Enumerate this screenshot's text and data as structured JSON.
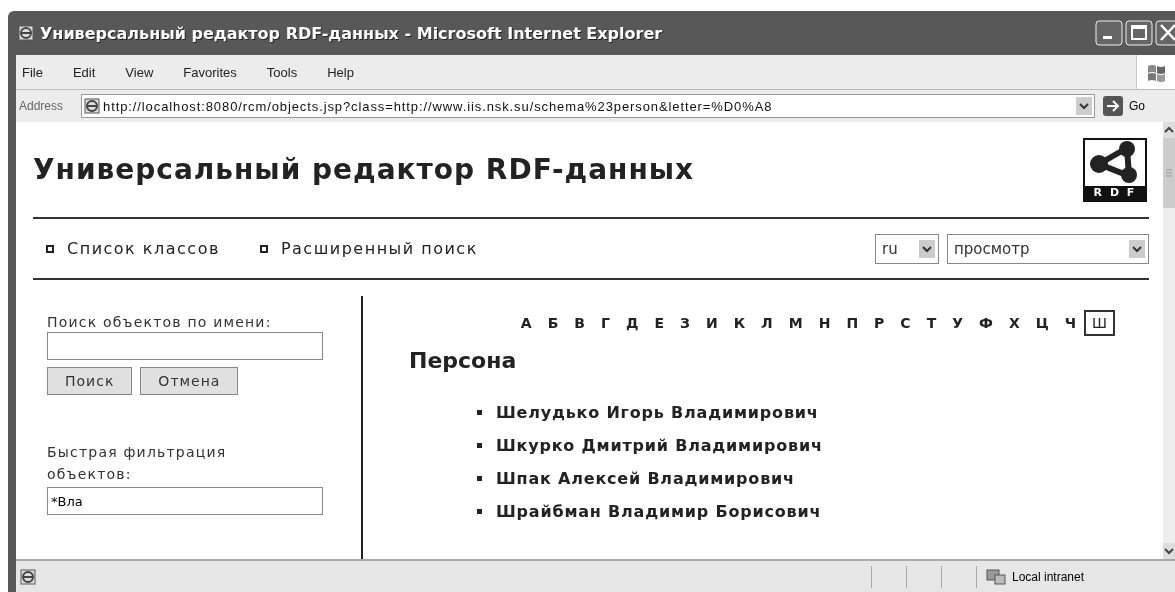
{
  "window": {
    "title": "Универсальный редактор RDF-данных - Microsoft Internet Explorer"
  },
  "menu": [
    "File",
    "Edit",
    "View",
    "Favorites",
    "Tools",
    "Help"
  ],
  "address": {
    "label": "Address",
    "url": "http://localhost:8080/rcm/objects.jsp?class=http://www.iis.nsk.su/schema%23person&letter=%D0%A8",
    "go": "Go"
  },
  "page": {
    "heading": "Универсальный редактор RDF-данных",
    "logo_text": "R D F",
    "nav": [
      "Список классов",
      "Расширенный поиск"
    ],
    "language": "ru",
    "mode": "просмотр"
  },
  "sidebar": {
    "search_label": "Поиск объектов по имени:",
    "buttons": [
      "Поиск",
      "Отмена"
    ],
    "filter_label": "Быстрая фильтрация объектов:",
    "filter_value": "*Вла"
  },
  "letters": [
    {
      "label": "А",
      "selected": false
    },
    {
      "label": "Б",
      "selected": false
    },
    {
      "label": "В",
      "selected": false
    },
    {
      "label": "Г",
      "selected": false
    },
    {
      "label": "Д",
      "selected": false
    },
    {
      "label": "Е",
      "selected": false
    },
    {
      "label": "З",
      "selected": false
    },
    {
      "label": "И",
      "selected": false
    },
    {
      "label": "К",
      "selected": false
    },
    {
      "label": "Л",
      "selected": false
    },
    {
      "label": "М",
      "selected": false
    },
    {
      "label": "Н",
      "selected": false
    },
    {
      "label": "П",
      "selected": false
    },
    {
      "label": "Р",
      "selected": false
    },
    {
      "label": "С",
      "selected": false
    },
    {
      "label": "Т",
      "selected": false
    },
    {
      "label": "У",
      "selected": false
    },
    {
      "label": "Ф",
      "selected": false
    },
    {
      "label": "Х",
      "selected": false
    },
    {
      "label": "Ц",
      "selected": false
    },
    {
      "label": "Ч",
      "selected": false
    },
    {
      "label": "Ш",
      "selected": true
    }
  ],
  "class_title": "Персона",
  "objects": [
    "Шелудько Игорь Владимирович",
    "Шкурко Дмитрий Владимирович",
    "Шпак Алексей Владимирович",
    "Шрайбман Владимир Борисович"
  ],
  "status_bar": {
    "zone": "Local intranet"
  }
}
